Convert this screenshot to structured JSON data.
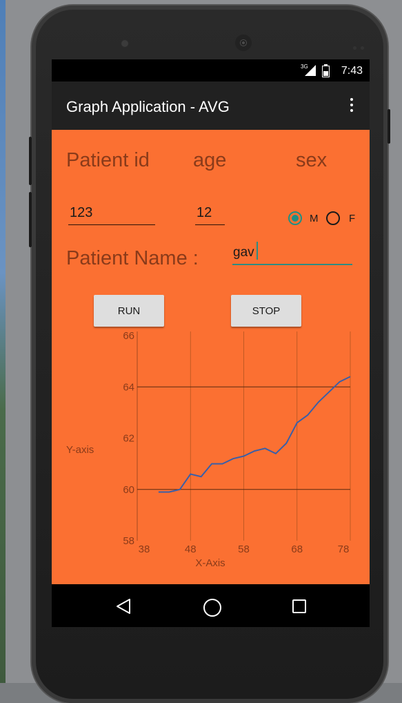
{
  "statusbar": {
    "network": "3G",
    "time": "7:43"
  },
  "appbar": {
    "title": "Graph Application - AVG"
  },
  "form": {
    "patient_id_label": "Patient id",
    "age_label": "age",
    "sex_label": "sex",
    "patient_id_value": "123",
    "age_value": "12",
    "sex_options": [
      "M",
      "F"
    ],
    "sex_selected": "M",
    "patient_name_label": "Patient Name :",
    "patient_name_value": "gav"
  },
  "buttons": {
    "run": "RUN",
    "stop": "STOP"
  },
  "chart_data": {
    "type": "line",
    "xlabel": "X-Axis",
    "ylabel": "Y-axis",
    "xlim": [
      38,
      78
    ],
    "ylim": [
      58,
      66
    ],
    "xticks": [
      38,
      48,
      58,
      68,
      78
    ],
    "yticks": [
      58,
      60,
      62,
      64,
      66
    ],
    "grid": true,
    "series": [
      {
        "color": "#3a5fa8",
        "x": [
          42,
          44,
          46,
          48,
          50,
          52,
          54,
          56,
          58,
          60,
          62,
          64,
          66,
          68,
          70,
          72,
          74,
          76,
          78
        ],
        "y": [
          59.9,
          59.9,
          60.0,
          60.6,
          60.5,
          61.0,
          61.0,
          61.2,
          61.3,
          61.5,
          61.6,
          61.4,
          61.8,
          62.6,
          62.9,
          63.4,
          63.8,
          64.2,
          64.4
        ]
      }
    ]
  },
  "colors": {
    "screen_bg": "#fb7032",
    "appbar_bg": "#212121",
    "accent": "#1f8f84",
    "line": "#3a5fa8"
  },
  "navbar": {
    "icons": [
      "back-icon",
      "home-icon",
      "recents-icon"
    ]
  }
}
